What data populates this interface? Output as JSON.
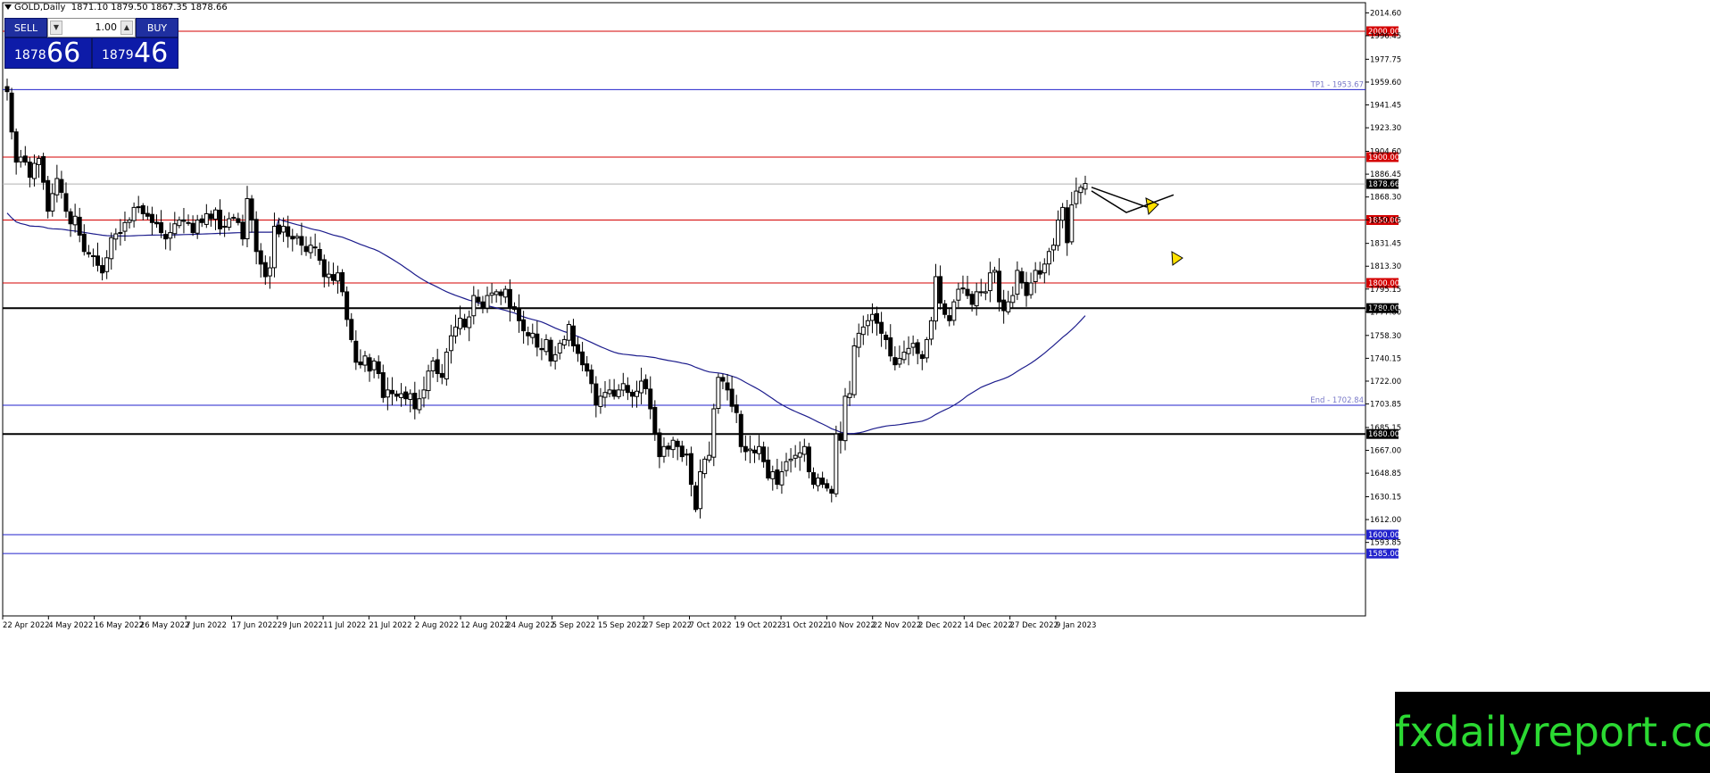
{
  "header": {
    "symbol": "GOLD,Daily",
    "ohlc": "1871.10 1879.50 1867.35 1878.66"
  },
  "trade_panel": {
    "sell_label": "SELL",
    "buy_label": "BUY",
    "lot": "1.00",
    "sell_small": "1878",
    "sell_big": "66",
    "buy_small": "1879",
    "buy_big": "46"
  },
  "watermark": "fxdailyreport.com",
  "colors": {
    "red_line": "#d40000",
    "blue_line": "#2222cc",
    "ma_line": "#1c1c8c",
    "black_line": "#000000",
    "arrow_fill": "#ffe100"
  },
  "chart_data": {
    "type": "candlestick",
    "title": "",
    "xlabel": "",
    "ylabel": "",
    "ylim": [
      1580.0,
      2020.0
    ],
    "y_ticks": [
      "2014.60",
      "1996.45",
      "1977.75",
      "1959.60",
      "1941.45",
      "1923.30",
      "1904.60",
      "1886.45",
      "1868.30",
      "1850.15",
      "1831.45",
      "1813.30",
      "1795.15",
      "1777.00",
      "1758.30",
      "1740.15",
      "1722.00",
      "1703.85",
      "1685.15",
      "1667.00",
      "1648.85",
      "1630.15",
      "1612.00",
      "1593.85"
    ],
    "x_labels": [
      "22 Apr 2022",
      "4 May 2022",
      "16 May 2022",
      "26 May 2022",
      "7 Jun 2022",
      "17 Jun 2022",
      "29 Jun 2022",
      "11 Jul 2022",
      "21 Jul 2022",
      "2 Aug 2022",
      "12 Aug 2022",
      "24 Aug 2022",
      "5 Sep 2022",
      "15 Sep 2022",
      "27 Sep 2022",
      "7 Oct 2022",
      "19 Oct 2022",
      "31 Oct 2022",
      "10 Nov 2022",
      "22 Nov 2022",
      "2 Dec 2022",
      "14 Dec 2022",
      "27 Dec 2022",
      "9 Jan 2023"
    ],
    "current_price": "1878.66",
    "levels": [
      {
        "value": 2000.0,
        "label": "2000.00",
        "color": "red"
      },
      {
        "value": 1953.67,
        "label": "TP1 - 1953.67",
        "color": "blue",
        "note": true
      },
      {
        "value": 1900.0,
        "label": "1900.00",
        "color": "red"
      },
      {
        "value": 1850.0,
        "label": "1850.00",
        "color": "red"
      },
      {
        "value": 1800.0,
        "label": "1800.00",
        "color": "red"
      },
      {
        "value": 1780.0,
        "label": "1780.00",
        "color": "black"
      },
      {
        "value": 1702.84,
        "label": "End - 1702.84",
        "color": "blue",
        "note": true
      },
      {
        "value": 1680.0,
        "label": "1680.00",
        "color": "black"
      },
      {
        "value": 1600.0,
        "label": "1600.00",
        "color": "blue"
      },
      {
        "value": 1585.0,
        "label": "1585.00",
        "color": "blue"
      }
    ],
    "closes": [
      1952,
      1920,
      1896,
      1900,
      1896,
      1884,
      1895,
      1899,
      1880,
      1857,
      1871,
      1883,
      1872,
      1857,
      1847,
      1853,
      1838,
      1825,
      1823,
      1821,
      1814,
      1808,
      1820,
      1836,
      1839,
      1840,
      1848,
      1850,
      1860,
      1860,
      1855,
      1853,
      1848,
      1847,
      1840,
      1835,
      1840,
      1847,
      1850,
      1849,
      1848,
      1840,
      1850,
      1848,
      1855,
      1851,
      1858,
      1843,
      1845,
      1851,
      1852,
      1848,
      1835,
      1867,
      1850,
      1825,
      1815,
      1805,
      1812,
      1845,
      1839,
      1845,
      1837,
      1835,
      1837,
      1830,
      1825,
      1830,
      1828,
      1818,
      1805,
      1807,
      1802,
      1808,
      1793,
      1771,
      1755,
      1737,
      1735,
      1742,
      1730,
      1738,
      1728,
      1709,
      1715,
      1712,
      1710,
      1712,
      1708,
      1712,
      1700,
      1708,
      1715,
      1730,
      1738,
      1728,
      1725,
      1745,
      1758,
      1765,
      1772,
      1765,
      1773,
      1790,
      1785,
      1780,
      1790,
      1792,
      1793,
      1790,
      1795,
      1780,
      1779,
      1770,
      1762,
      1758,
      1760,
      1749,
      1747,
      1755,
      1738,
      1743,
      1752,
      1755,
      1767,
      1750,
      1744,
      1735,
      1730,
      1720,
      1703,
      1710,
      1713,
      1715,
      1710,
      1715,
      1720,
      1713,
      1710,
      1714,
      1722,
      1716,
      1700,
      1680,
      1662,
      1670,
      1668,
      1675,
      1670,
      1662,
      1664,
      1640,
      1620,
      1650,
      1660,
      1663,
      1700,
      1725,
      1722,
      1715,
      1702,
      1697,
      1670,
      1666,
      1668,
      1665,
      1670,
      1658,
      1645,
      1650,
      1640,
      1650,
      1658,
      1660,
      1663,
      1665,
      1670,
      1650,
      1640,
      1645,
      1640,
      1637,
      1633,
      1680,
      1675,
      1710,
      1712,
      1750,
      1760,
      1765,
      1770,
      1775,
      1768,
      1760,
      1755,
      1742,
      1735,
      1740,
      1745,
      1748,
      1752,
      1744,
      1740,
      1755,
      1770,
      1805,
      1784,
      1775,
      1770,
      1785,
      1795,
      1796,
      1790,
      1783,
      1793,
      1793,
      1793,
      1808,
      1810,
      1785,
      1778,
      1785,
      1790,
      1810,
      1800,
      1790,
      1800,
      1810,
      1807,
      1815,
      1825,
      1830,
      1850,
      1860,
      1832,
      1862,
      1873,
      1876,
      1879
    ],
    "ma_series": [
      {
        "name": "",
        "values": []
      }
    ]
  },
  "annotations": {
    "arrows": [
      "up",
      "down-then-up"
    ]
  }
}
